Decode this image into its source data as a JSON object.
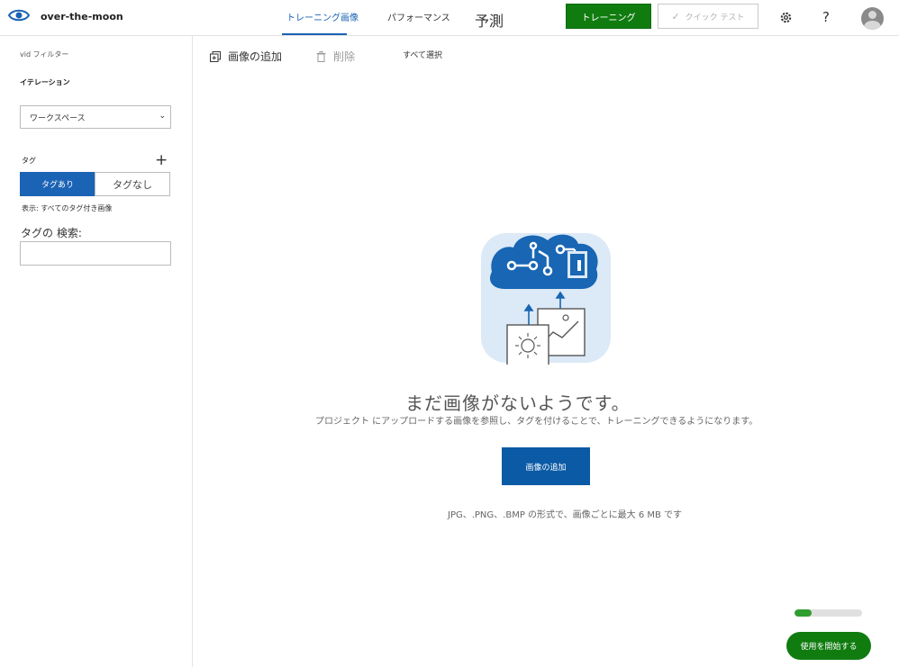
{
  "app": {
    "title": "over-the-moon",
    "logo_icon": "eye-icon"
  },
  "nav": {
    "tabs": [
      {
        "label": "トレーニング画像",
        "active": true
      },
      {
        "label": "パフォーマンス",
        "active": false
      },
      {
        "label": "予測",
        "active": false
      }
    ]
  },
  "header": {
    "train_label": "トレーニング",
    "quick_test_label": "クイック テスト",
    "settings_icon": "gear-icon",
    "help_icon": "help-icon",
    "avatar_icon": "user-icon"
  },
  "sidebar": {
    "filter_label": "vid フィルター",
    "iteration_label": "イテレーション",
    "iteration_value": "ワークスペース",
    "tags_label": "タグ",
    "tagged_label": "タグあり",
    "untagged_label": "タグなし",
    "show_label": "表示: すべてのタグ付き画像",
    "search_label": "タグの 検索:",
    "search_value": ""
  },
  "toolbar": {
    "add_label": "画像の追加",
    "delete_label": "削除",
    "select_all_label": "すべて選択"
  },
  "empty_state": {
    "title": "まだ画像がないようです。",
    "subtitle": "プロジェクト にアップロードする画像を参照し、タグを付けることで、トレーニングできるようになります。",
    "add_button_label": "画像の追加",
    "formats_text": "JPG、.PNG、.BMP の形式で、画像ごとに最大 6 MB です"
  },
  "footer": {
    "progress_fraction": 0.25,
    "start_label": "使用を開始する"
  },
  "colors": {
    "accent_blue": "#1b63b5",
    "train_green": "#107c10"
  }
}
